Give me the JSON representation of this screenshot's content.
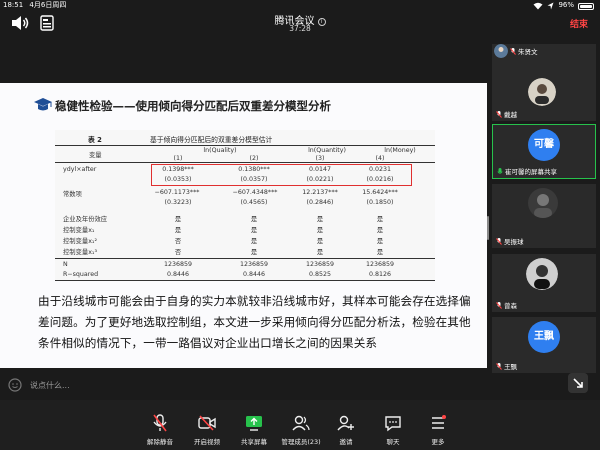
{
  "status_bar": {
    "time": "18:51",
    "date": "4月6日周四",
    "battery": "96%"
  },
  "meeting": {
    "app_title": "腾讯会议",
    "elapsed": "37:28",
    "end_label": "结束"
  },
  "slide": {
    "title": "稳健性检验——使用倾向得分匹配后双重差分模型分析",
    "table": {
      "number": "表 2",
      "title": "基于倾向得分匹配后的双重差分模型估计",
      "var_header": "变量",
      "col_headers": [
        "ln(Quality)",
        "ln(Quantity)",
        "ln(Money)"
      ],
      "col_numbers": [
        "(1)",
        "(2)",
        "(3)",
        "(4)"
      ],
      "rows": [
        {
          "label": "ydyl×after",
          "values": [
            "0.1398***",
            "0.1380***",
            "0.0147",
            "0.0231"
          ],
          "se": [
            "(0.0353)",
            "(0.0357)",
            "(0.0221)",
            "(0.0216)"
          ]
        },
        {
          "label": "常数项",
          "values": [
            "−607.1173***",
            "−607.4348***",
            "12.2137***",
            "15.6424***"
          ],
          "se": [
            "(0.3223)",
            "(0.4565)",
            "(0.2846)",
            "(0.1850)"
          ]
        },
        {
          "label": "企业及年份效应",
          "values": [
            "是",
            "是",
            "是",
            "是"
          ]
        },
        {
          "label": "控制变量x₁",
          "values": [
            "是",
            "是",
            "是",
            "是"
          ]
        },
        {
          "label": "控制变量x₁²",
          "values": [
            "否",
            "是",
            "是",
            "是"
          ]
        },
        {
          "label": "控制变量x₁³",
          "values": [
            "否",
            "是",
            "是",
            "是"
          ]
        },
        {
          "label": "N",
          "values": [
            "1236859",
            "1236859",
            "1236859",
            "1236859"
          ]
        },
        {
          "label": "R−squared",
          "values": [
            "0.8446",
            "0.8446",
            "0.8525",
            "0.8126"
          ]
        }
      ]
    },
    "paragraph": "由于沿线城市可能会由于自身的实力本就较非沿线城市好，其样本可能会存在选择偏差问题。为了更好地选取控制组，本文进一步采用倾向得分匹配分析法，检验在其他条件相似的情况下，一带一路倡议对企业出口增长之间的因果关系"
  },
  "chat": {
    "placeholder": "说点什么..."
  },
  "participants": [
    {
      "name": "朱贤文",
      "muted": true
    },
    {
      "name": "戴越",
      "muted": true
    },
    {
      "name": "崔可馨的屏幕共享",
      "avatar_text": "可馨",
      "active": true
    },
    {
      "name": "吴振球",
      "muted": true
    },
    {
      "name": "曾森",
      "muted": true
    },
    {
      "name": "王飘",
      "avatar_text": "王飘",
      "muted": true
    }
  ],
  "toolbar": {
    "items": [
      {
        "label": "解除静音",
        "icon": "mic-off-icon"
      },
      {
        "label": "开启视频",
        "icon": "video-off-icon"
      },
      {
        "label": "共享屏幕",
        "icon": "share-screen-icon"
      },
      {
        "label": "管理成员(23)",
        "icon": "members-icon"
      },
      {
        "label": "邀请",
        "icon": "invite-icon"
      },
      {
        "label": "聊天",
        "icon": "chat-icon"
      },
      {
        "label": "更多",
        "icon": "more-icon"
      }
    ]
  },
  "colors": {
    "end_red": "#ff4444",
    "active_green": "#27c24c",
    "avatar_blue": "#2f7ff0",
    "highlight_red": "#e03030"
  }
}
